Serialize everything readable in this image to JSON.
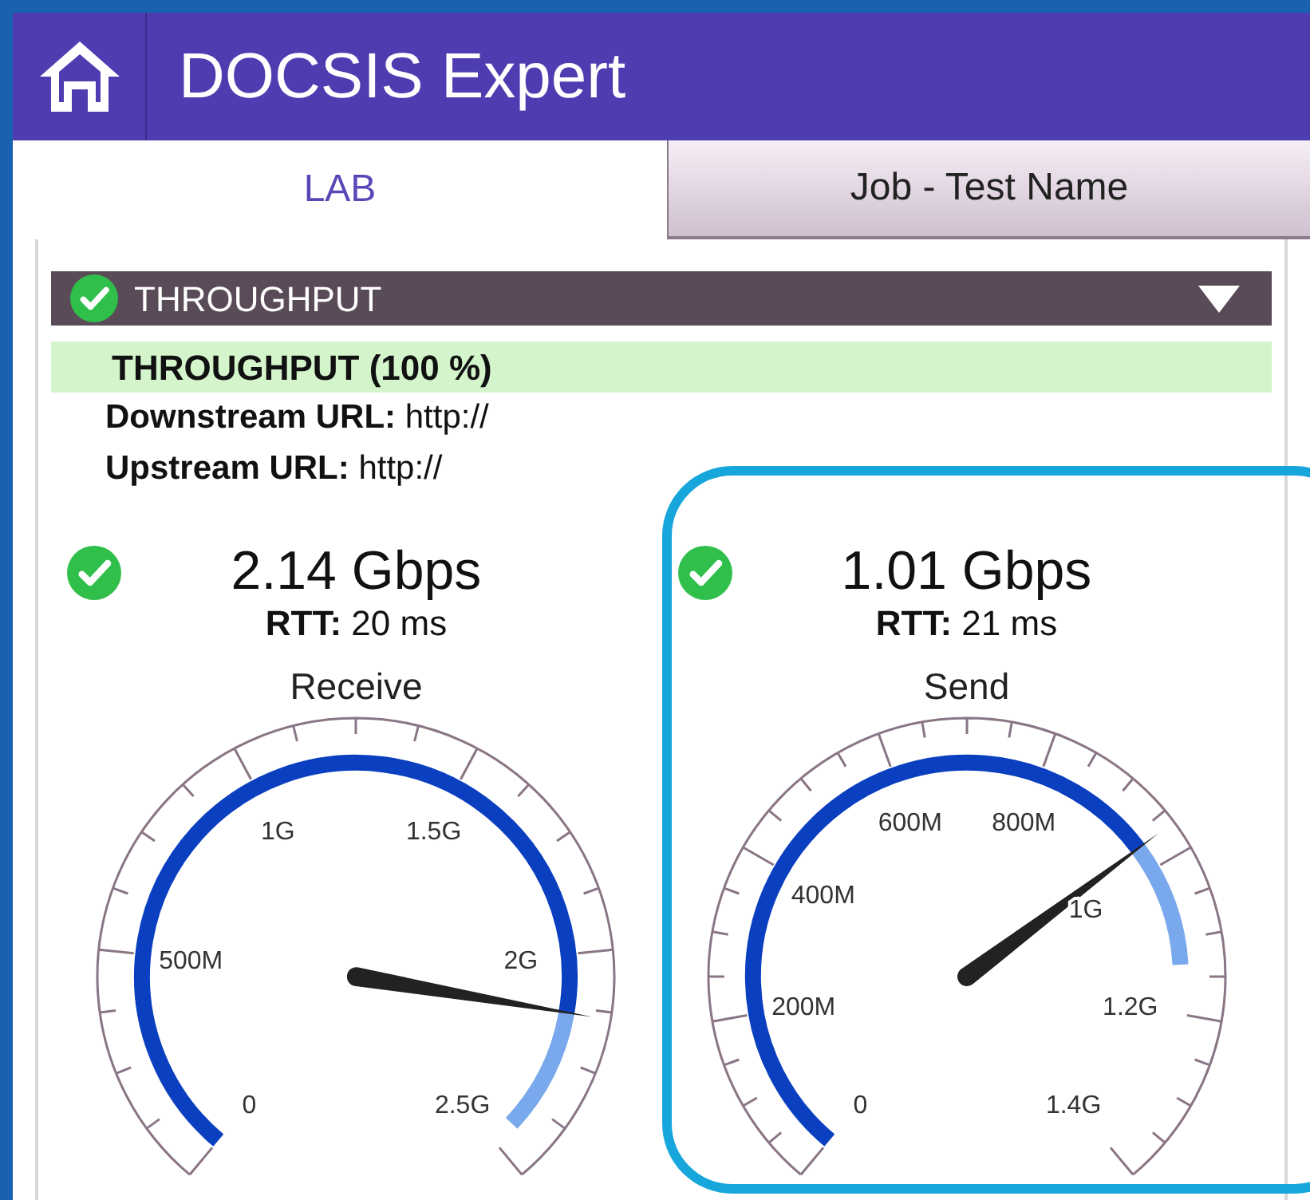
{
  "app": {
    "title": "DOCSIS Expert"
  },
  "tabs": [
    {
      "label": "LAB",
      "selected": true
    },
    {
      "label": "Job - Test Name",
      "selected": false
    }
  ],
  "section": {
    "title": "THROUGHPUT",
    "passed": true,
    "expanded": true
  },
  "summary": "THROUGHPUT (100 %)",
  "fields": [
    "**Downstream URL:** http://",
    "**Upstream URL:** http://"
  ],
  "results": [
    {
      "passed": true,
      "rate": "2.14 Gbps",
      "rtt": "**RTT:** 20 ms",
      "direction": "Receive",
      "scale": [
        "0",
        "500M",
        "1G",
        "1.5G",
        "2G",
        "2.5G"
      ],
      "highlighted": false
    },
    {
      "passed": true,
      "rate": "1.01 Gbps",
      "rtt": "**RTT:** 21 ms",
      "direction": "Send",
      "scale": [
        "0",
        "200M",
        "400M",
        "600M",
        "800M",
        "1G",
        "1.2G",
        "1.4G"
      ],
      "highlighted": true
    }
  ]
}
